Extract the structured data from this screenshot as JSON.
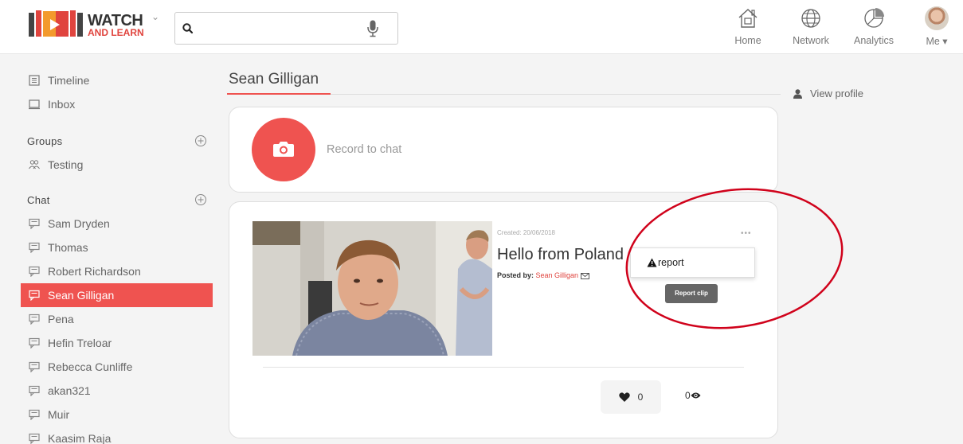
{
  "header": {
    "logo": {
      "line1": "WATCH",
      "line2": "AND LEARN",
      "caret": "⌄"
    },
    "search": {
      "value": "",
      "placeholder": ""
    },
    "nav": [
      {
        "label": "Home",
        "icon": "home-icon"
      },
      {
        "label": "Network",
        "icon": "globe-icon"
      },
      {
        "label": "Analytics",
        "icon": "pie-chart-icon"
      },
      {
        "label": "Me ▾",
        "icon": "avatar"
      }
    ]
  },
  "sidebar": {
    "top_items": [
      {
        "label": "Timeline",
        "icon": "timeline-icon"
      },
      {
        "label": "Inbox",
        "icon": "inbox-icon"
      }
    ],
    "groups_header": "Groups",
    "groups": [
      {
        "label": "Testing",
        "icon": "group-icon"
      }
    ],
    "chat_header": "Chat",
    "chats": [
      {
        "label": "Sam Dryden"
      },
      {
        "label": "Thomas"
      },
      {
        "label": "Robert Richardson"
      },
      {
        "label": "Sean Gilligan",
        "active": true
      },
      {
        "label": "Pena"
      },
      {
        "label": "Hefin Treloar"
      },
      {
        "label": "Rebecca Cunliffe"
      },
      {
        "label": "akan321"
      },
      {
        "label": "Muir"
      },
      {
        "label": "Kaasim Raja"
      }
    ]
  },
  "main": {
    "title": "Sean Gilligan",
    "record_label": "Record to chat",
    "post": {
      "created": "Created: 20/06/2018",
      "title": "Hello from Poland",
      "posted_by_label": "Posted by:",
      "author": "Sean Gilligan",
      "more": "•••",
      "menu_item": "report",
      "tooltip": "Report clip",
      "likes": "0",
      "views": "0"
    }
  },
  "right_panel": {
    "view_profile": "View profile"
  },
  "colors": {
    "accent": "#ef5350",
    "annotation_circle": "#d0021b"
  }
}
